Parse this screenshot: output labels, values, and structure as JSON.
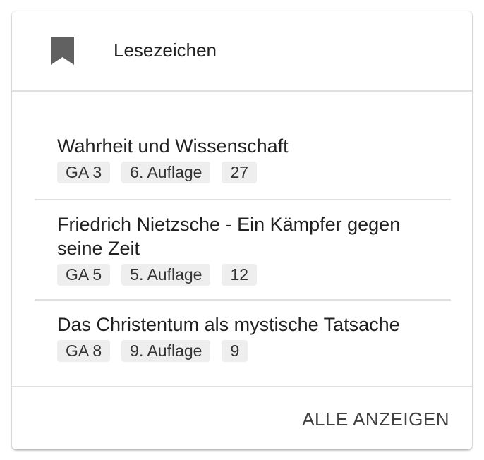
{
  "header": {
    "icon": "bookmark-icon",
    "title": "Lesezeichen"
  },
  "bookmarks": [
    {
      "title": "Wahrheit und Wissenschaft",
      "ga": "GA 3",
      "edition": "6. Auflage",
      "page": "27"
    },
    {
      "title": "Friedrich Nietzsche - Ein Kämpfer gegen seine Zeit",
      "ga": "GA 5",
      "edition": "5. Auflage",
      "page": "12"
    },
    {
      "title": "Das Christentum als mystische Tatsache",
      "ga": "GA 8",
      "edition": "9. Auflage",
      "page": "9"
    }
  ],
  "footer": {
    "show_all_label": "ALLE ANZEIGEN"
  },
  "colors": {
    "icon": "#616161",
    "text": "#212121",
    "chip_bg": "#eeeeee",
    "divider": "#e0e0e0"
  }
}
